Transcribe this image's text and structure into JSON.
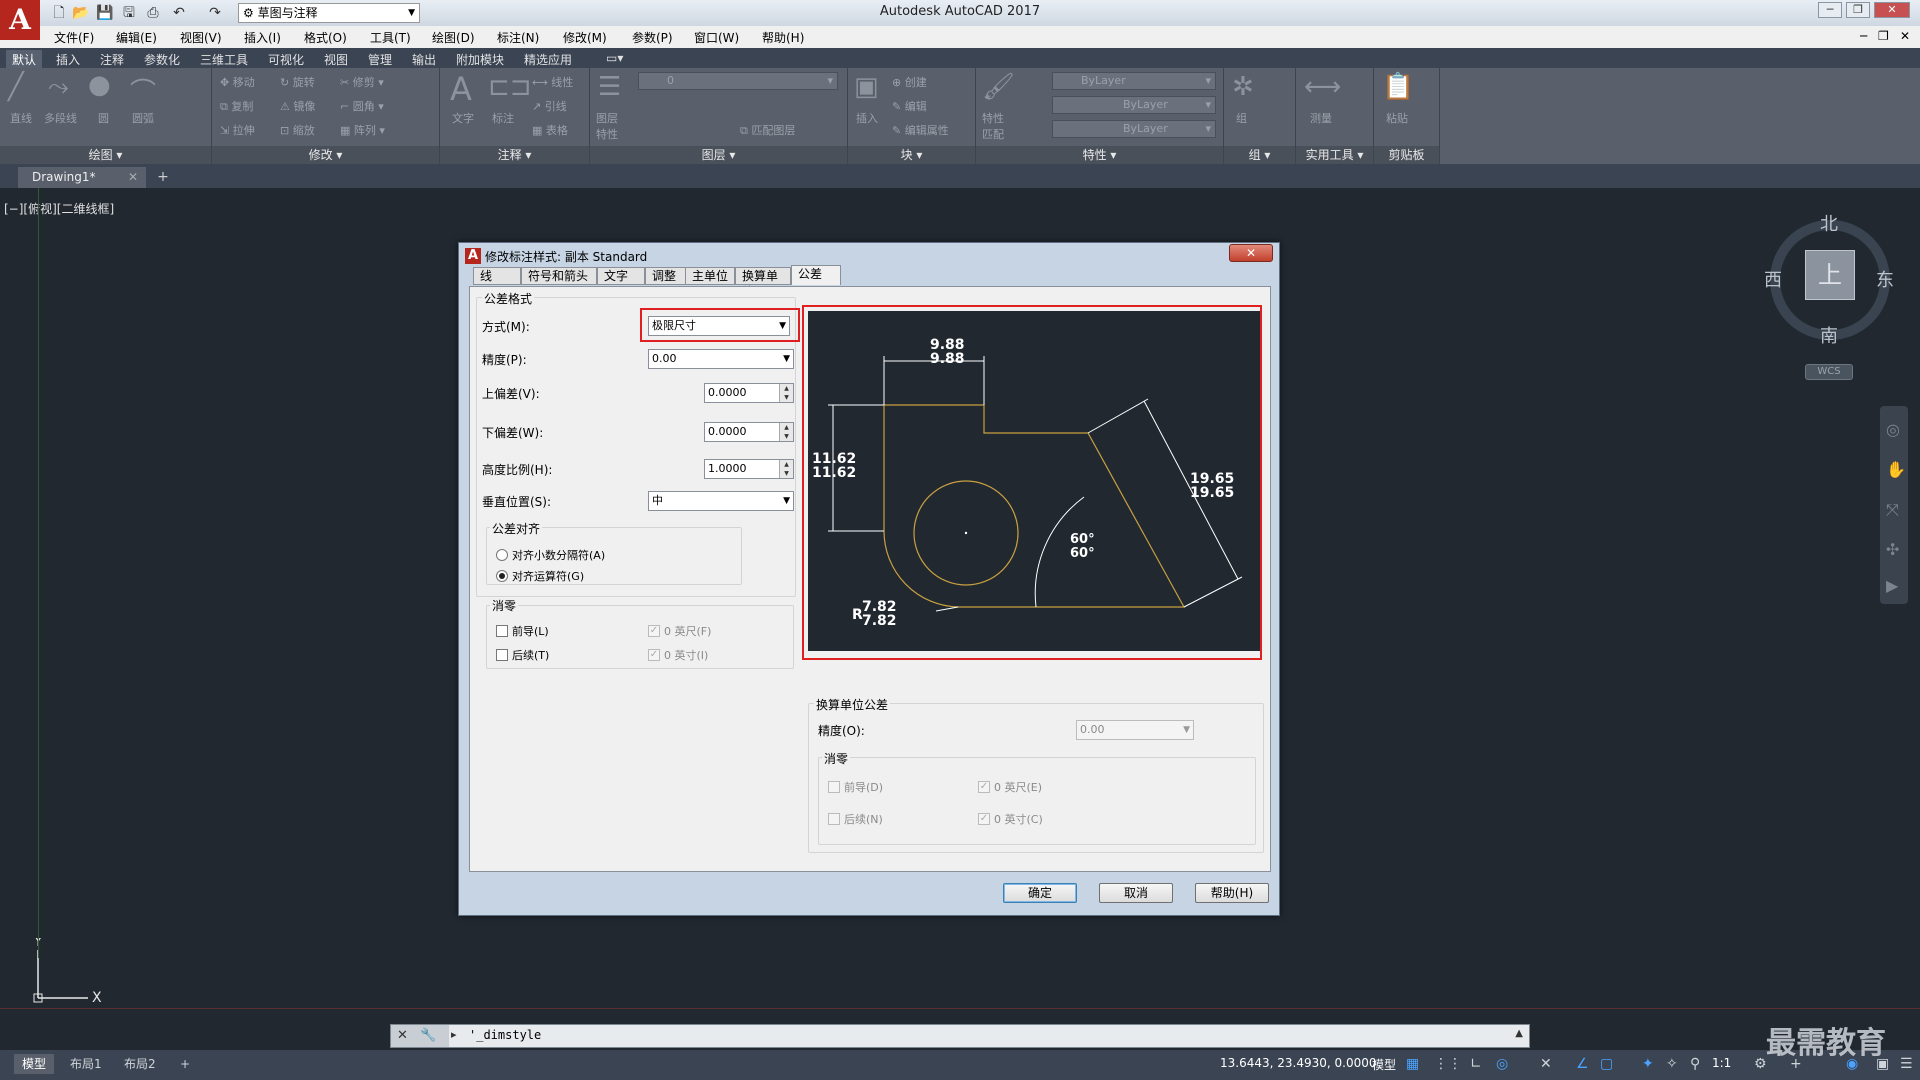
{
  "app": {
    "title": "Autodesk AutoCAD 2017",
    "logo": "A",
    "workspace": "草图与注释"
  },
  "menu": [
    "文件(F)",
    "编辑(E)",
    "视图(V)",
    "插入(I)",
    "格式(O)",
    "工具(T)",
    "绘图(D)",
    "标注(N)",
    "修改(M)",
    "参数(P)",
    "窗口(W)",
    "帮助(H)"
  ],
  "ribbon_tabs": [
    "默认",
    "插入",
    "注释",
    "参数化",
    "三维工具",
    "可视化",
    "视图",
    "管理",
    "输出",
    "附加模块",
    "精选应用"
  ],
  "ribbon_panels": [
    "绘图",
    "修改",
    "注释",
    "图层",
    "块",
    "特性",
    "组",
    "实用工具",
    "剪贴板"
  ],
  "ribbon_labels": {
    "line": "直线",
    "polyline": "多段线",
    "circle": "圆",
    "arc": "圆弧",
    "move": "移动",
    "rotate": "旋转",
    "trim": "修剪",
    "copy": "复制",
    "mirror": "镜像",
    "fillet": "圆角",
    "stretch": "拉伸",
    "scale": "缩放",
    "array": "阵列",
    "text": "文字",
    "dimension": "标注",
    "linear": "线性",
    "leader": "引线",
    "table": "表格",
    "layer_props": "图层特性",
    "match_layer": "匹配图层",
    "insert": "插入",
    "create": "创建",
    "edit": "编辑",
    "edit_attr": "编辑属性",
    "match_props": "特性匹配",
    "bylayer1": "ByLayer",
    "bylayer2": "ByLayer",
    "bylayer3": "ByLayer",
    "group": "组",
    "measure": "测量",
    "paste": "粘贴",
    "layer_value": "0"
  },
  "doc_tab": "Drawing1*",
  "viewport_label": "[−][俯视][二维线框]",
  "viewcube": {
    "north": "北",
    "south": "南",
    "east": "东",
    "west": "西",
    "face": "上",
    "wcs": "WCS"
  },
  "dialog": {
    "title": "修改标注样式: 副本 Standard",
    "tabs": [
      "线",
      "符号和箭头",
      "文字",
      "调整",
      "主单位",
      "换算单位",
      "公差"
    ],
    "active_tab": "公差",
    "tolerance_format": {
      "group_label": "公差格式",
      "method_label": "方式(M):",
      "method_value": "极限尺寸",
      "precision_label": "精度(P):",
      "precision_value": "0.00",
      "upper_label": "上偏差(V):",
      "upper_value": "0.0000",
      "lower_label": "下偏差(W):",
      "lower_value": "0.0000",
      "height_label": "高度比例(H):",
      "height_value": "1.0000",
      "vertical_label": "垂直位置(S):",
      "vertical_value": "中"
    },
    "alignment": {
      "group_label": "公差对齐",
      "opt1": "对齐小数分隔符(A)",
      "opt2": "对齐运算符(G)"
    },
    "zero_supp": {
      "group_label": "消零",
      "leading": "前导(L)",
      "trailing": "后续(T)",
      "feet": "0 英尺(F)",
      "inches": "0 英寸(I)"
    },
    "alt_units": {
      "group_label": "换算单位公差",
      "precision_label": "精度(O):",
      "precision_value": "0.00",
      "zero_label": "消零",
      "leading": "前导(D)",
      "trailing": "后续(N)",
      "feet": "0 英尺(E)",
      "inches": "0 英寸(C)"
    },
    "buttons": {
      "ok": "确定",
      "cancel": "取消",
      "help": "帮助(H)"
    },
    "close": "✕",
    "preview": {
      "dim_top1": "9.88",
      "dim_top2": "9.88",
      "dim_left1": "11.62",
      "dim_left2": "11.62",
      "dim_right1": "19.65",
      "dim_right2": "19.65",
      "angle1": "60°",
      "angle2": "60°",
      "radius_prefix": "R",
      "radius1": "7.82",
      "radius2": "7.82"
    }
  },
  "command": {
    "text": "'_dimstyle"
  },
  "status": {
    "layouts": [
      "模型",
      "布局1",
      "布局2"
    ],
    "coords": "13.6443, 23.4930, 0.0000",
    "model": "模型",
    "scale": "1:1",
    "watermark": "最需教育"
  },
  "colors": {
    "accent_red": "#e02020",
    "canvas": "#212830",
    "ribbon": "#59606b",
    "geometry": "#c8a040"
  }
}
